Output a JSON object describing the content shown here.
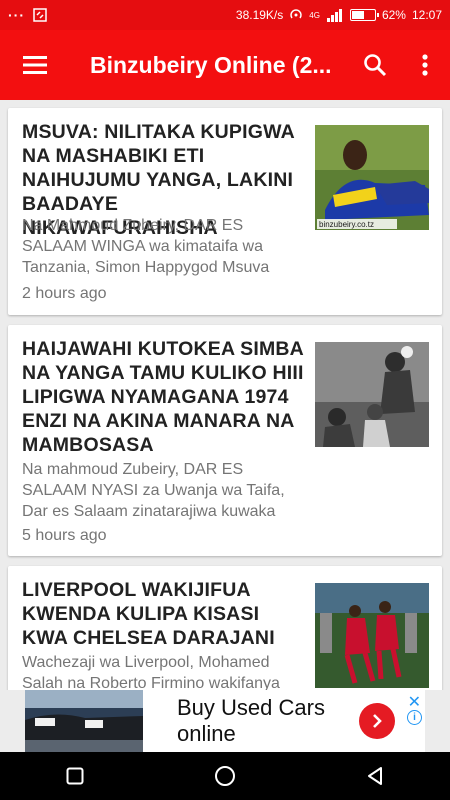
{
  "status_bar": {
    "net_speed": "38.19K/s",
    "battery": "62%",
    "battery_level": 0.62,
    "time": "12:07",
    "network": "4G"
  },
  "app_bar": {
    "title": "Binzubeiry Online (2...",
    "icons": [
      "menu-icon",
      "search-icon",
      "more-vert-icon"
    ]
  },
  "articles": [
    {
      "title": "MSUVA: NILITAKA KUPIGWA NA MASHABIKI ETI NAIHUJUMU YANGA, LAKINI BAADAYE NIKAWAFURAHISHA",
      "excerpt": "Na Mahmoud Zubeiry, DAR ES SALAAM WINGA wa kimataifa wa Tanzania, Simon Happygod Msuva",
      "time": "2 hours ago",
      "thumb_caption": "binzubeiry.co.tz"
    },
    {
      "title": "HAIJAWAHI KUTOKEA SIMBA NA YANGA TAMU KULIKO HIII LIPIGWA NYAMAGANA 1974 ENZI NA AKINA MANARA NA MAMBOSASA",
      "excerpt": "Na mahmoud Zubeiry, DAR ES SALAAM NYASI za Uwanja wa Taifa, Dar es Salaam zinatarajiwa kuwaka",
      "time": "5 hours ago"
    },
    {
      "title": "LIVERPOOL WAKIJIFUA KWENDA KULIPA KISASI KWA CHELSEA DARAJANI",
      "excerpt": "Wachezaji wa Liverpool, Mohamed Salah na Roberto Firmino wakifanya",
      "time": ""
    }
  ],
  "ad": {
    "text": "Buy Used Cars online",
    "close": "✕",
    "info": "i"
  },
  "colors": {
    "app_bar": "#f30f10",
    "status_bar": "#e50d10",
    "ad_button": "#e51b23",
    "ad_icons": "#2196f3"
  }
}
